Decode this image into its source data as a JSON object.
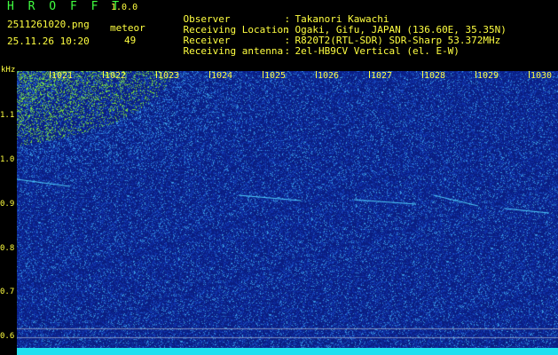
{
  "header": {
    "app_name": "H R O F F T",
    "app_version": "1.0.0",
    "filename": "2511261020.png",
    "datetime": "25.11.26 10:20",
    "meteor_label": "meteor",
    "meteor_count": "49"
  },
  "info": [
    {
      "key": "Observer",
      "value": "Takanori Kawachi"
    },
    {
      "key": "Receiving Location",
      "value": "Ogaki, Gifu, JAPAN (136.60E, 35.35N)"
    },
    {
      "key": "Receiver",
      "value": "R820T2(RTL-SDR) SDR-Sharp 53.372MHz"
    },
    {
      "key": "Receiving antenna",
      "value": "2el-HB9CV Vertical (el. E-W)"
    }
  ],
  "axis": {
    "unit": "kHz",
    "y_labels": [
      "1.1",
      "1.0",
      "0.9",
      "0.8",
      "0.7",
      "0.6"
    ],
    "time_labels": [
      "1021",
      "1022",
      "1023",
      "1024",
      "1025",
      "1026",
      "1027",
      "1028",
      "1029",
      "1030"
    ]
  },
  "colors": {
    "text_yellow": "#ffff40",
    "title_green": "#40ff40",
    "spectrogram_base": "#10208a",
    "strip": "#20e0f0"
  }
}
